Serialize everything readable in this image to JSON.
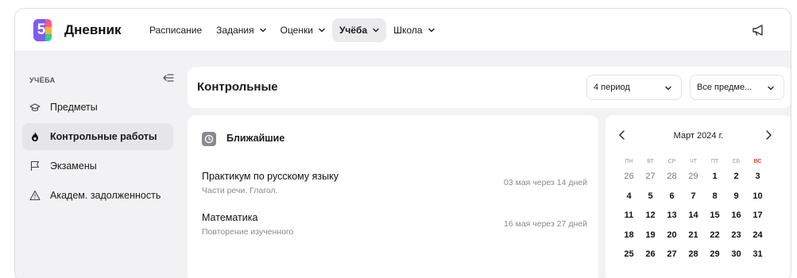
{
  "app": {
    "logo_number": "5",
    "title": "Дневник"
  },
  "nav": [
    {
      "label": "Расписание",
      "has_dropdown": false,
      "active": false
    },
    {
      "label": "Задания",
      "has_dropdown": true,
      "active": false
    },
    {
      "label": "Оценки",
      "has_dropdown": true,
      "active": false
    },
    {
      "label": "Учёба",
      "has_dropdown": true,
      "active": true
    },
    {
      "label": "Школа",
      "has_dropdown": true,
      "active": false
    }
  ],
  "sidebar": {
    "heading": "УЧЁБА",
    "items": [
      {
        "label": "Предметы",
        "icon": "graduation-cap-icon",
        "active": false
      },
      {
        "label": "Контрольные работы",
        "icon": "flame-icon",
        "active": true
      },
      {
        "label": "Экзамены",
        "icon": "flag-icon",
        "active": false
      },
      {
        "label": "Академ. задолженность",
        "icon": "warning-icon",
        "active": false
      }
    ]
  },
  "header": {
    "title": "Контрольные",
    "period_select": "4 период",
    "subject_select": "Все предме..."
  },
  "upcoming": {
    "title": "Ближайшие",
    "items": [
      {
        "subject": "Практикум по русскому языку",
        "topic": "Части речи. Глагол.",
        "due": "03 мая через 14 дней"
      },
      {
        "subject": "Математика",
        "topic": "Повторение изученного",
        "due": "16 мая через 27 дней"
      }
    ]
  },
  "calendar": {
    "month": "Март 2024 г.",
    "weekdays": [
      "ПН",
      "ВТ",
      "СР",
      "ЧТ",
      "ПТ",
      "СБ",
      "ВС"
    ],
    "weeks": [
      [
        {
          "d": "26",
          "other": true
        },
        {
          "d": "27",
          "other": true
        },
        {
          "d": "28",
          "other": true
        },
        {
          "d": "29",
          "other": true
        },
        {
          "d": "1"
        },
        {
          "d": "2"
        },
        {
          "d": "3"
        }
      ],
      [
        {
          "d": "4"
        },
        {
          "d": "5"
        },
        {
          "d": "6"
        },
        {
          "d": "7"
        },
        {
          "d": "8"
        },
        {
          "d": "9"
        },
        {
          "d": "10"
        }
      ],
      [
        {
          "d": "11"
        },
        {
          "d": "12"
        },
        {
          "d": "13"
        },
        {
          "d": "14"
        },
        {
          "d": "15"
        },
        {
          "d": "16"
        },
        {
          "d": "17"
        }
      ],
      [
        {
          "d": "18"
        },
        {
          "d": "19"
        },
        {
          "d": "20"
        },
        {
          "d": "21"
        },
        {
          "d": "22"
        },
        {
          "d": "23"
        },
        {
          "d": "24"
        }
      ],
      [
        {
          "d": "25"
        },
        {
          "d": "26"
        },
        {
          "d": "27"
        },
        {
          "d": "28"
        },
        {
          "d": "29"
        },
        {
          "d": "30"
        },
        {
          "d": "31"
        }
      ]
    ]
  },
  "colors": {
    "accent_purple": "#7e5cf0",
    "sunday_red": "#e0433c",
    "page_bg": "#f2f2f4"
  }
}
